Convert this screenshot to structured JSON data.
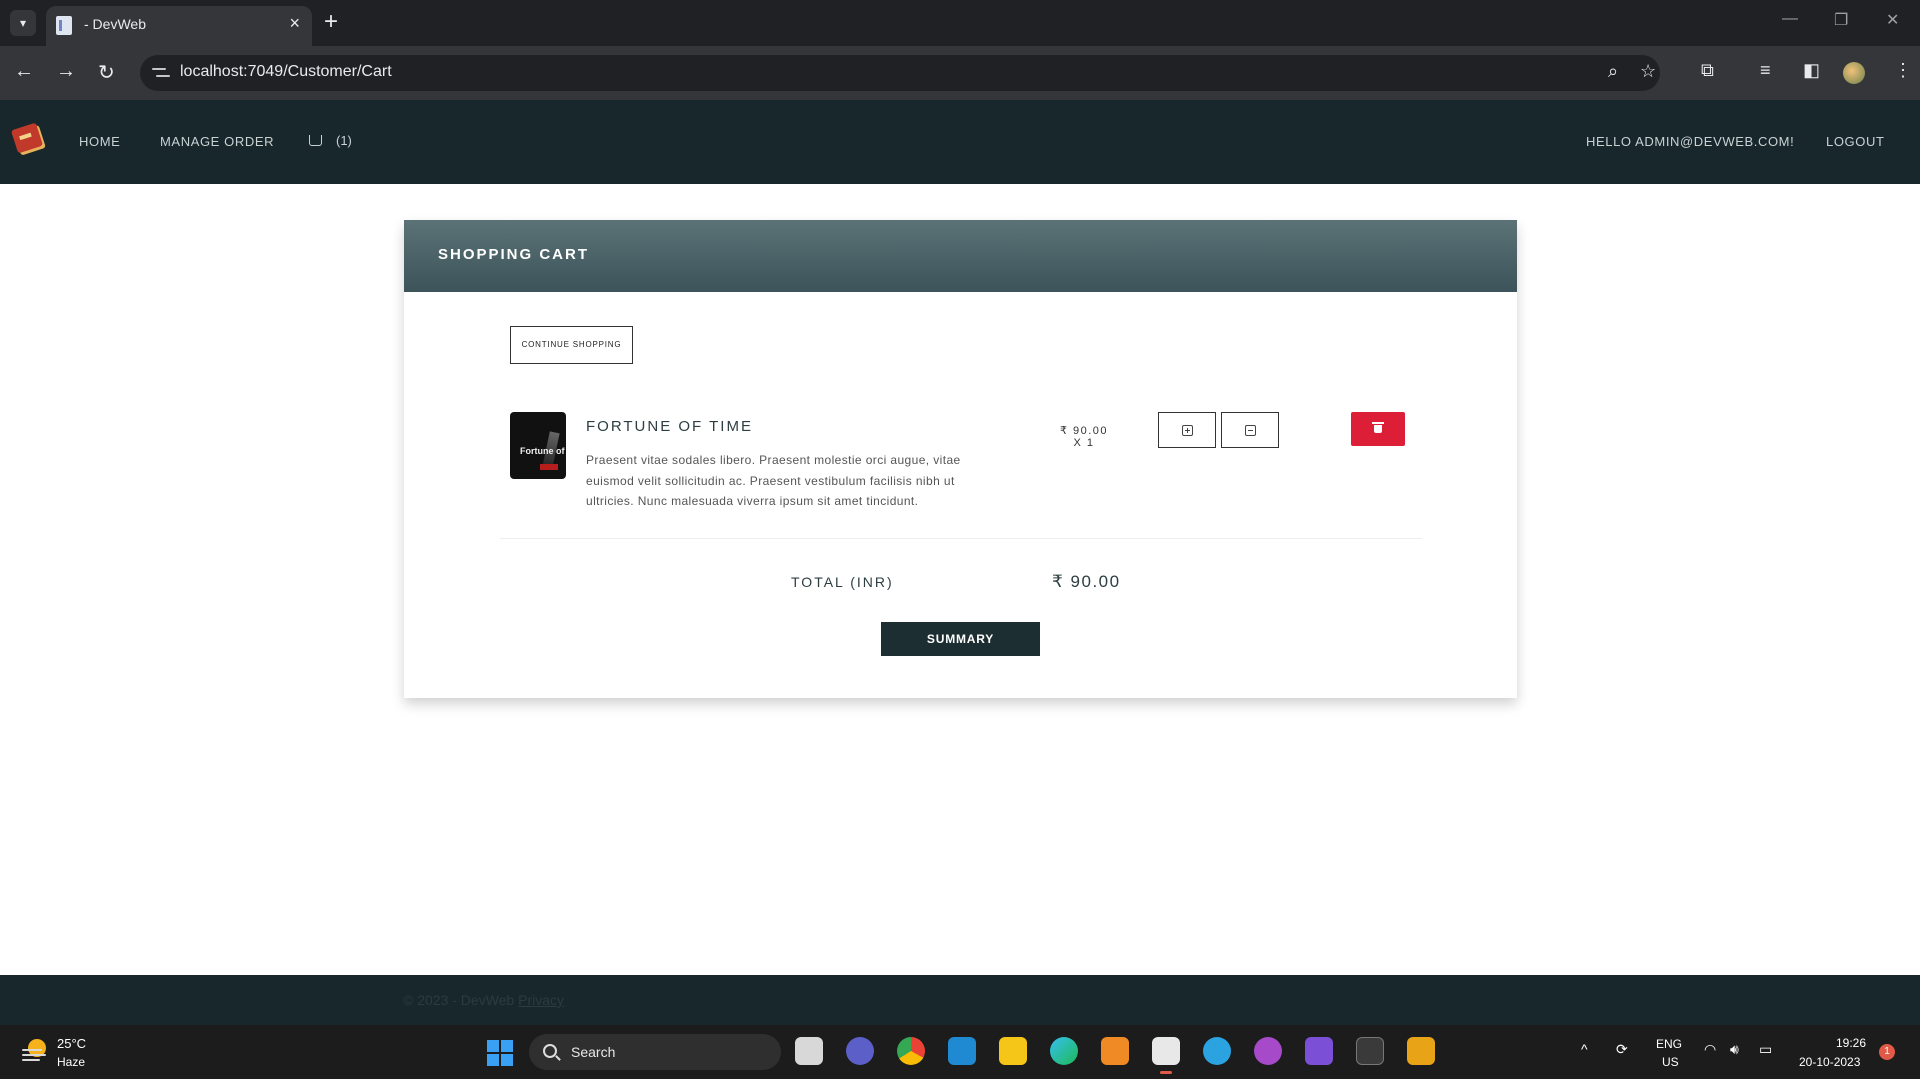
{
  "browser": {
    "tab_title": "- DevWeb",
    "url": "localhost:7049/Customer/Cart"
  },
  "navbar": {
    "home": "Home",
    "manage_order": "Manage Order",
    "cart_count": "(1)",
    "greeting": "Hello admin@devweb.com!",
    "logout": "Logout"
  },
  "cart": {
    "title": "SHOPPING CART",
    "continue_label": "CONTINUE SHOPPING",
    "item": {
      "cover_text": "Fortune of",
      "name": "Fortune of Time",
      "description": "Praesent vitae sodales libero. Praesent molestie orci augue, vitae euismod velit sollicitudin ac. Praesent vestibulum facilisis nibh ut ultricies. Nunc malesuada viverra ipsum sit amet tincidunt.",
      "price": "₹ 90.00",
      "quantity": "X 1"
    },
    "total_label": "TOTAL (INR)",
    "total_value": "₹ 90.00",
    "summary_label": "SUMMARY"
  },
  "footer": {
    "text": "© 2023 - DevWeb ",
    "privacy": "Privacy"
  },
  "taskbar": {
    "temperature": "25°C",
    "weather": "Haze",
    "search_label": "Search",
    "lang_line1": "ENG",
    "lang_line2": "US",
    "time": "19:26",
    "date": "20-10-2023",
    "notification_count": "1"
  },
  "colors": {
    "navbar_bg": "#17272b",
    "header_gradient_top": "#5b7377",
    "header_gradient_bottom": "#3c5459",
    "delete_red": "#dc1f36",
    "summary_bg": "#1d2e32"
  }
}
